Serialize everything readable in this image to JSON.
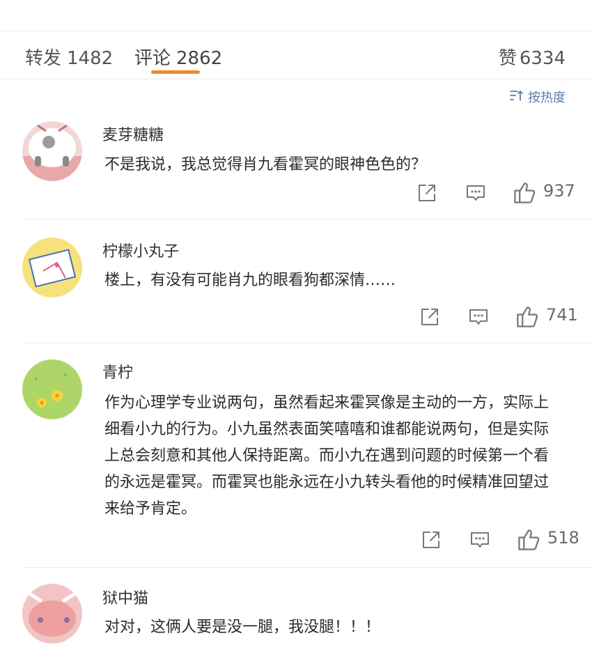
{
  "tabs": {
    "repost": {
      "label": "转发",
      "count": "1482"
    },
    "comments": {
      "label": "评论",
      "count": "2862"
    },
    "likes": {
      "label": "赞",
      "count": "6334"
    }
  },
  "sort": {
    "label": "按热度",
    "icon": "sort-icon"
  },
  "colors": {
    "accent": "#f08a2c",
    "link": "#5a7ea8"
  },
  "comments": [
    {
      "username": "麦芽糖糖",
      "text": "不是我说，我总觉得肖九看霍冥的眼神色色的？",
      "likes": "937"
    },
    {
      "username": "柠檬小丸子",
      "text": "楼上，有没有可能肖九的眼看狗都深情……",
      "likes": "741"
    },
    {
      "username": "青柠",
      "text": "作为心理学专业说两句，虽然看起来霍冥像是主动的一方，实际上细看小九的行为。小九虽然表面笑嘻嘻和谁都能说两句，但是实际上总会刻意和其他人保持距离。而小九在遇到问题的时候第一个看的永远是霍冥。而霍冥也能永远在小九转头看他的时候精准回望过来给予肯定。",
      "likes": "518"
    },
    {
      "username": "狱中猫",
      "text": "对对，这俩人要是没一腿，我没腿！！！"
    }
  ]
}
